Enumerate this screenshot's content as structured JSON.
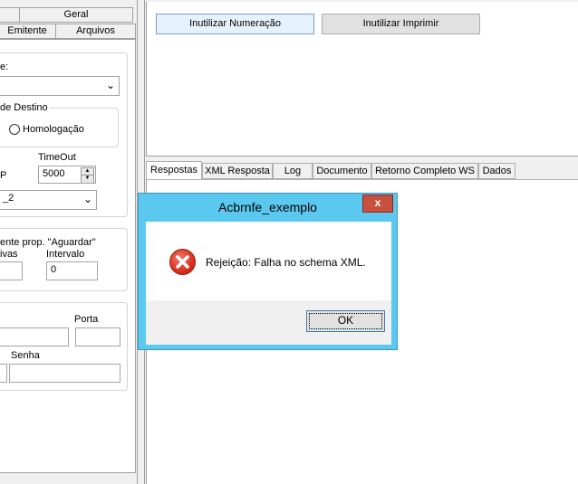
{
  "left": {
    "tabs_top": [
      "",
      "Geral"
    ],
    "tabs_bottom": [
      "Emitente",
      "Arquivos"
    ],
    "form_label": "e:",
    "ambiente_label": "de Destino",
    "radio_homologacao": "Homologação",
    "timeout_label": "TimeOut",
    "p_label": "P",
    "timeout_value": "5000",
    "ssl_value": "_2",
    "aguardar_line1": "ente prop. \"Aguardar\"",
    "tentativas_label": "ivas",
    "intervalo_label": "Intervalo",
    "intervalo_value": "0",
    "porta_label": "Porta",
    "senha_label": "Senha"
  },
  "toolbar": {
    "inutilizar_numeracao": "Inutilizar Numeração",
    "inutilizar_imprimir": "Inutilizar Imprimir"
  },
  "result_tabs": [
    "Respostas",
    "XML Resposta",
    "Log",
    "Documento",
    "Retorno Completo WS",
    "Dados"
  ],
  "dialog": {
    "title": "Acbrnfe_exemplo",
    "close_glyph": "x",
    "message": "Rejeição: Falha no schema XML.",
    "ok_label": "OK",
    "icon": "error-icon"
  },
  "colors": {
    "dialog_frame": "#5ac8ef",
    "close_button": "#c7503f",
    "error_red": "#d9301f"
  }
}
